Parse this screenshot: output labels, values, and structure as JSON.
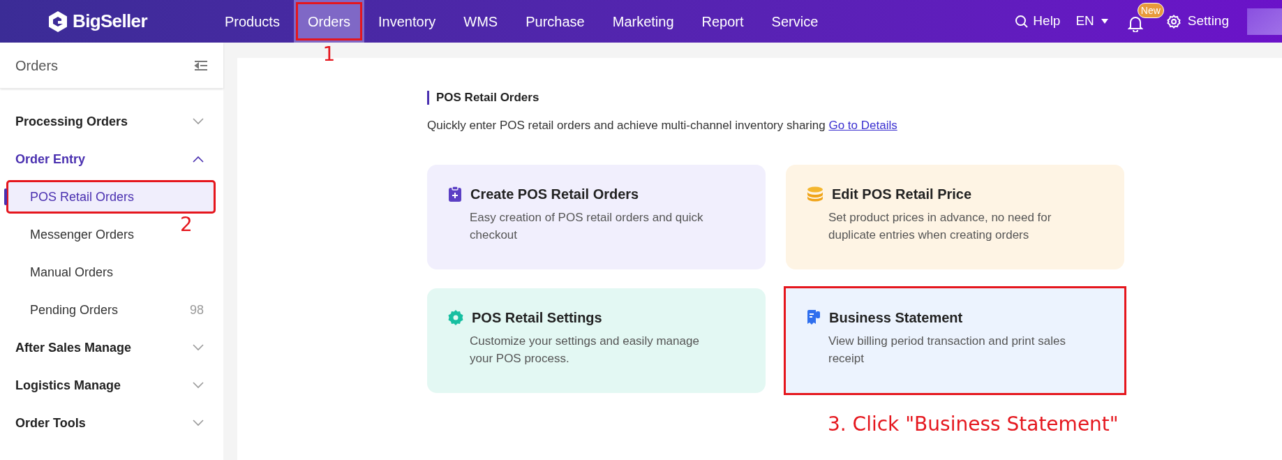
{
  "header": {
    "logo": "BigSeller",
    "menu": [
      {
        "label": "Products",
        "selected": false
      },
      {
        "label": "Orders",
        "selected": true,
        "annotation": "1"
      },
      {
        "label": "Inventory",
        "selected": false
      },
      {
        "label": "WMS",
        "selected": false
      },
      {
        "label": "Purchase",
        "selected": false
      },
      {
        "label": "Marketing",
        "selected": false
      },
      {
        "label": "Report",
        "selected": false
      },
      {
        "label": "Service",
        "selected": false
      }
    ],
    "help": "Help",
    "language": "EN",
    "notification_badge": "New",
    "setting": "Setting"
  },
  "sidebar": {
    "title": "Orders",
    "groups": [
      {
        "label": "Processing Orders",
        "expanded": false
      },
      {
        "label": "Order Entry",
        "expanded": true,
        "children": [
          {
            "label": "POS Retail Orders",
            "selected": true,
            "annotation": "2"
          },
          {
            "label": "Messenger Orders",
            "selected": false
          },
          {
            "label": "Manual Orders",
            "selected": false
          },
          {
            "label": "Pending Orders",
            "selected": false,
            "count": "98"
          }
        ]
      },
      {
        "label": "After Sales Manage",
        "expanded": false
      },
      {
        "label": "Logistics Manage",
        "expanded": false
      },
      {
        "label": "Order Tools",
        "expanded": false
      }
    ]
  },
  "content": {
    "title": "POS Retail Orders",
    "description": "Quickly enter POS retail orders and achieve multi-channel inventory sharing",
    "link": "Go to Details",
    "cards": [
      {
        "kind": "create",
        "title": "Create POS Retail Orders",
        "description": "Easy creation of POS retail orders and quick checkout"
      },
      {
        "kind": "price",
        "title": "Edit POS Retail Price",
        "description": "Set product prices in advance, no need for duplicate entries when creating orders"
      },
      {
        "kind": "settings",
        "title": "POS Retail Settings",
        "description": "Customize your settings and easily manage your POS process."
      },
      {
        "kind": "statement",
        "title": "Business Statement",
        "description": "View billing period transaction and print sales receipt",
        "annotation": "3. Click \"Business Statement\""
      }
    ]
  }
}
